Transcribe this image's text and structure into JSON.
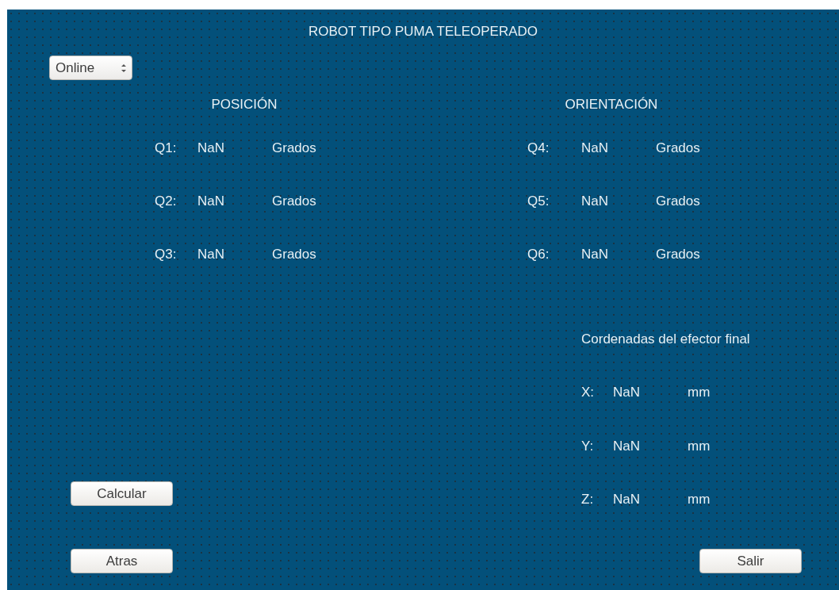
{
  "window": {
    "title": "ROBOT TIPO PUMA TELEOPERADO"
  },
  "mode_select": {
    "value": "Online"
  },
  "position": {
    "heading": "POSICIÓN",
    "joints": [
      {
        "label": "Q1:",
        "value": "NaN",
        "unit": "Grados"
      },
      {
        "label": "Q2:",
        "value": "NaN",
        "unit": "Grados"
      },
      {
        "label": "Q3:",
        "value": "NaN",
        "unit": "Grados"
      }
    ]
  },
  "orientation": {
    "heading": "ORIENTACIÓN",
    "joints": [
      {
        "label": "Q4:",
        "value": "NaN",
        "unit": "Grados"
      },
      {
        "label": "Q5:",
        "value": "NaN",
        "unit": "Grados"
      },
      {
        "label": "Q6:",
        "value": "NaN",
        "unit": "Grados"
      }
    ]
  },
  "end_effector": {
    "heading": "Cordenadas del efector final",
    "coords": [
      {
        "label": "X:",
        "value": "NaN",
        "unit": "mm"
      },
      {
        "label": "Y:",
        "value": "NaN",
        "unit": "mm"
      },
      {
        "label": "Z:",
        "value": "NaN",
        "unit": "mm"
      }
    ]
  },
  "buttons": {
    "calculate": "Calcular",
    "back": "Atras",
    "exit": "Salir"
  }
}
